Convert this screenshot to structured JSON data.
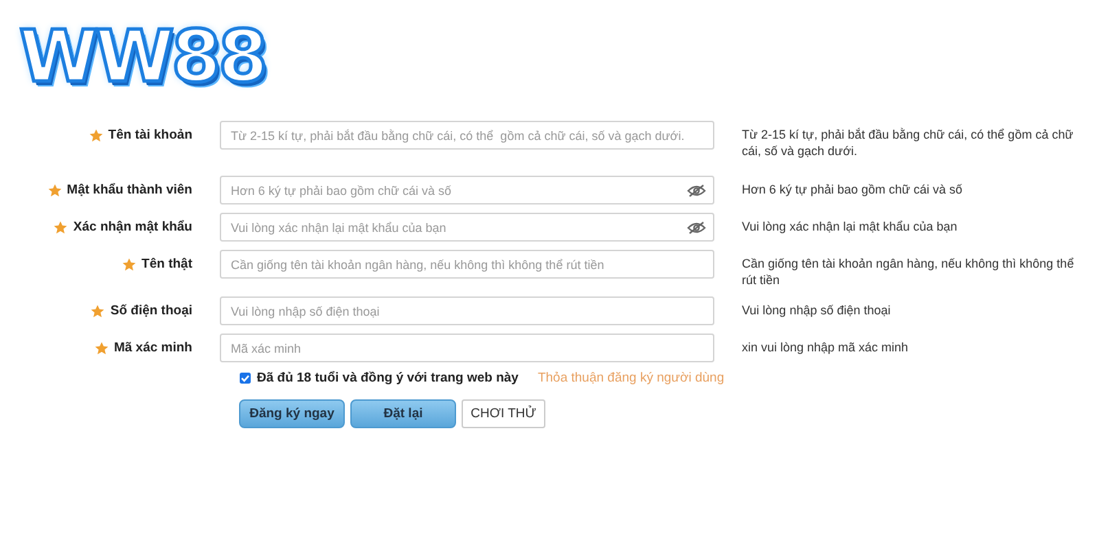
{
  "logo": {
    "text": "WW88"
  },
  "fields": [
    {
      "label": "Tên tài khoản",
      "kind": "text",
      "required": true,
      "placeholder": "Từ 2-15 kí tự, phải bắt đầu bằng chữ cái, có thể  gồm cả chữ cái, số và gạch dưới.",
      "hint": "Từ 2-15 kí tự, phải bắt đầu bằng chữ cái, có thể gồm cả chữ cái, số và gạch dưới."
    },
    {
      "label": "Mật khẩu thành viên",
      "kind": "password",
      "required": true,
      "placeholder": "Hơn 6 ký tự phải bao gồm chữ cái và số",
      "hint": "Hơn 6 ký tự phải bao gồm chữ cái và số"
    },
    {
      "label": "Xác nhận mật khẩu",
      "kind": "password",
      "required": true,
      "placeholder": "Vui lòng xác nhận lại mật khẩu của bạn",
      "hint": "Vui lòng xác nhận lại mật khẩu của bạn"
    },
    {
      "label": "Tên thật",
      "kind": "text",
      "required": true,
      "placeholder": "Cần giống tên tài khoản ngân hàng, nếu không thì không thể rút tiền",
      "hint": "Cần giống tên tài khoản ngân hàng, nếu không thì không thể rút tiền"
    },
    {
      "label": "Số điện thoại",
      "kind": "text",
      "required": true,
      "placeholder": "Vui lòng nhập số điện thoại",
      "hint": "Vui lòng nhập số điện thoại"
    },
    {
      "label": "Mã xác minh",
      "kind": "text",
      "required": true,
      "placeholder": "Mã xác minh",
      "hint": "xin vui lòng nhập mã xác minh"
    }
  ],
  "agreement": {
    "checked": true,
    "text": "Đã đủ 18 tuổi và đồng ý với trang web này",
    "link": "Thỏa thuận đăng ký người dùng"
  },
  "buttons": [
    {
      "label": "Đăng ký ngay",
      "kind": "primary"
    },
    {
      "label": "Đặt lại",
      "kind": "primary"
    },
    {
      "label": "CHƠI THỬ",
      "kind": "plain"
    }
  ]
}
